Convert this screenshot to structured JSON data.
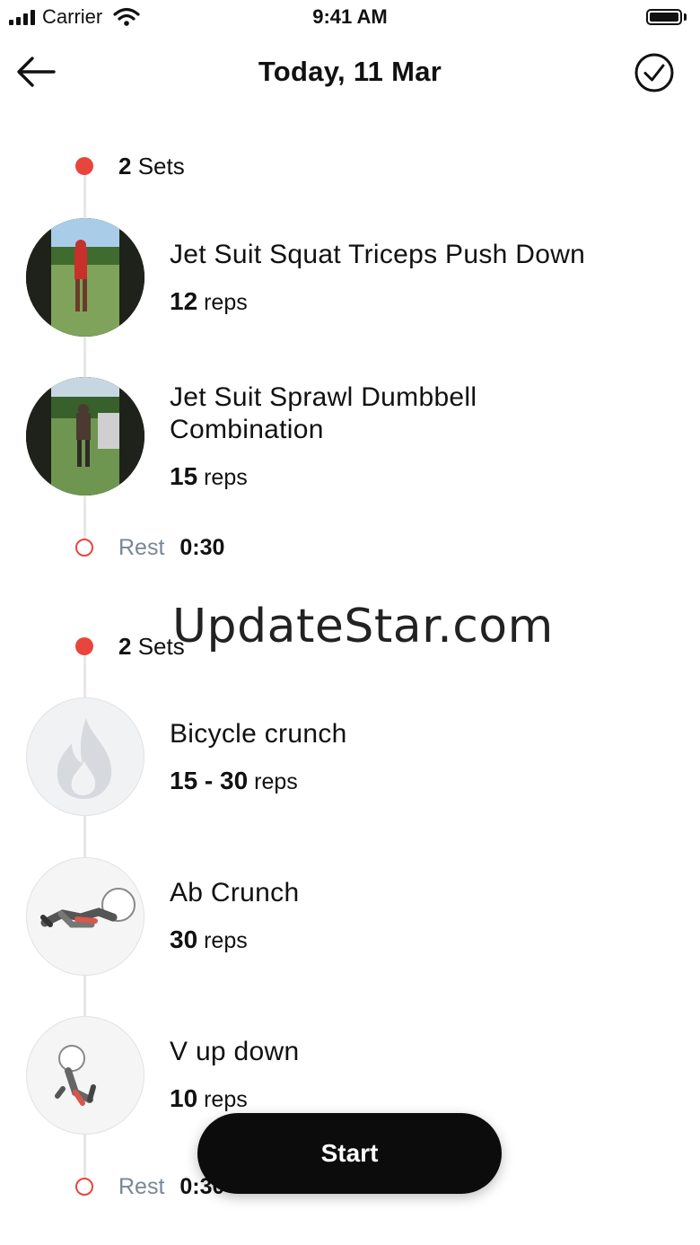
{
  "status_bar": {
    "carrier": "Carrier",
    "time": "9:41 AM"
  },
  "header": {
    "title": "Today, 11 Mar",
    "back_icon": "arrow-left-icon",
    "confirm_icon": "check-circle-icon"
  },
  "blocks": [
    {
      "sets": {
        "count": "2",
        "label": "Sets"
      },
      "exercises": [
        {
          "name": "Jet Suit Squat Triceps Push Down",
          "reps_value": "12",
          "reps_unit": "reps",
          "thumbnail": "workout-photo"
        },
        {
          "name": "Jet Suit Sprawl Dumbbell Combination",
          "reps_value": "15",
          "reps_unit": "reps",
          "thumbnail": "workout-photo"
        }
      ],
      "rest": {
        "label": "Rest",
        "time": "0:30"
      }
    },
    {
      "sets": {
        "count": "2",
        "label": "Sets"
      },
      "exercises": [
        {
          "name": "Bicycle crunch",
          "reps_value": "15 - 30",
          "reps_unit": "reps",
          "thumbnail": "flame-placeholder-icon"
        },
        {
          "name": "Ab Crunch",
          "reps_value": "30",
          "reps_unit": "reps",
          "thumbnail": "ab-crunch-figure"
        },
        {
          "name": "V up down",
          "reps_value": "10",
          "reps_unit": "reps",
          "thumbnail": "v-up-figure"
        }
      ],
      "rest": {
        "label": "Rest",
        "time": "0:30"
      }
    }
  ],
  "watermark": "UpdateStar.com",
  "start_button": {
    "label": "Start"
  },
  "colors": {
    "accent": "#e8453c",
    "rest_label": "#7a8797",
    "button": "#0c0c0c"
  }
}
